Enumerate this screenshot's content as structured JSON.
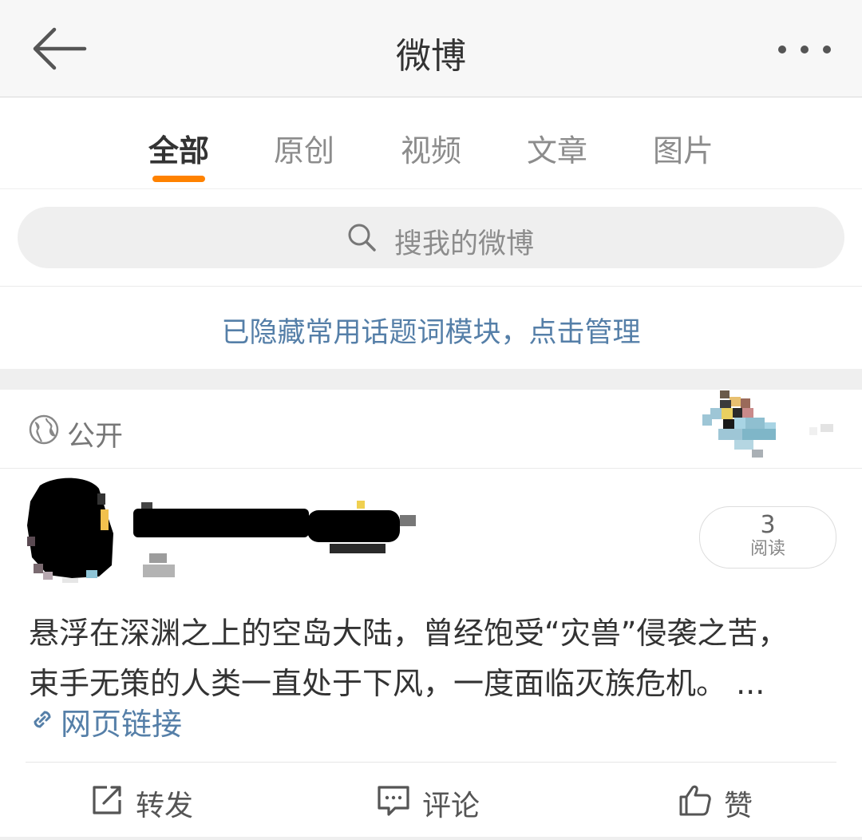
{
  "header": {
    "title": "微博"
  },
  "tabs": [
    {
      "label": "全部",
      "active": true
    },
    {
      "label": "原创",
      "active": false
    },
    {
      "label": "视频",
      "active": false
    },
    {
      "label": "文章",
      "active": false
    },
    {
      "label": "图片",
      "active": false
    }
  ],
  "search": {
    "placeholder": "搜我的微博"
  },
  "notice": {
    "text": "已隐藏常用话题词模块，点击管理"
  },
  "post": {
    "visibility": "公开",
    "read_count": "3",
    "read_label": "阅读",
    "text_line1": "悬浮在深渊之上的空岛大陆，曾经饱受“灾兽”侵袭之苦，",
    "text_line2": "束手无策的人类一直处于下风，一度面临灭族危机。 ...",
    "link_text": "网页链接",
    "actions": {
      "repost": "转发",
      "comment": "评论",
      "like": "赞"
    }
  },
  "colors": {
    "accent": "#ff8200",
    "link": "#557fa8"
  },
  "icons": [
    "back-arrow-icon",
    "more-icon",
    "search-icon",
    "globe-icon",
    "link-icon",
    "repost-icon",
    "comment-icon",
    "like-icon"
  ]
}
